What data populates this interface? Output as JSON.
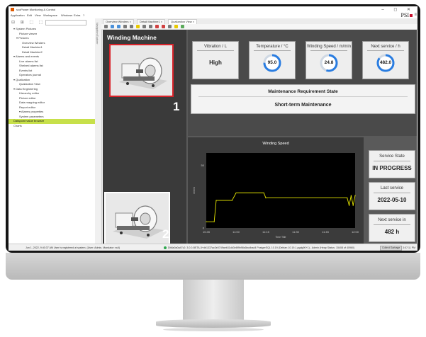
{
  "window": {
    "title": "scoPower Monitoring & Control",
    "controls": "– ◻ ✕",
    "brand": "PSI"
  },
  "menu": [
    "Application",
    "Edit",
    "View",
    "Workspace",
    "Windows",
    "Extra",
    "?"
  ],
  "nav": {
    "tools": "⊟ ⊞ ⬚ ⬚ ⊕",
    "side_label": "Navigation Explorer",
    "items": [
      {
        "label": "▾ System Pictures",
        "indent": 1
      },
      {
        "label": "Picture viewer",
        "indent": 3
      },
      {
        "label": "▾ Pictures",
        "indent": 2
      },
      {
        "label": "Overview Winders",
        "indent": 4
      },
      {
        "label": "Detail Machine1",
        "indent": 4
      },
      {
        "label": "Detail Machine2",
        "indent": 4
      },
      {
        "label": "▾ Alarms and events",
        "indent": 1
      },
      {
        "label": "Live alarms list",
        "indent": 3
      },
      {
        "label": "Shelved alarms list",
        "indent": 3
      },
      {
        "label": "Events list",
        "indent": 3
      },
      {
        "label": "Operators journal",
        "indent": 3
      },
      {
        "label": "▾ Qualization",
        "indent": 1
      },
      {
        "label": "Qualization View",
        "indent": 3
      },
      {
        "label": "▾ Data Engineering",
        "indent": 1
      },
      {
        "label": "Hierarchy editor",
        "indent": 3
      },
      {
        "label": "Picture editor",
        "indent": 3
      },
      {
        "label": "Data mapping editor",
        "indent": 3
      },
      {
        "label": "Report editor",
        "indent": 3
      },
      {
        "label": "▾ Alarms properties",
        "indent": 3
      },
      {
        "label": "System parameters",
        "indent": 3
      },
      {
        "label": "Datapoint value browser",
        "indent": 1,
        "selected": true
      },
      {
        "label": "Charts",
        "indent": 1
      }
    ]
  },
  "tabs": [
    {
      "label": "Overview Winders ×",
      "active": false
    },
    {
      "label": "Detail Machine1 ×",
      "active": false
    },
    {
      "label": "Qualization View ×",
      "active": true
    }
  ],
  "toolbar": {
    "icon_colors": [
      "#7a7a7a",
      "#4a90d9",
      "#4a90d9",
      "#7a7a7a",
      "#7a7a7a",
      "#e8c900",
      "#7a7a7a",
      "#7a7a7a",
      "#d04040",
      "#d04040",
      "#7a7a7a",
      "#e8c900",
      "#5aaa5a"
    ]
  },
  "dashboard": {
    "title": "Winding Machine",
    "machine1_number": "1",
    "machine2_number": "2",
    "cards": [
      {
        "key": "vibration",
        "label": "Vibration / L",
        "value": "High",
        "gauge": false
      },
      {
        "key": "temperature",
        "label": "Temperature / °C",
        "value": "95.0",
        "gauge": true,
        "fraction": 0.75
      },
      {
        "key": "speed",
        "label": "Winding Speed / m/min",
        "value": "24.8",
        "gauge": true,
        "fraction": 0.55
      },
      {
        "key": "nextservice",
        "label": "Next service / h",
        "value": "482.0",
        "gauge": true,
        "fraction": 0.85
      }
    ],
    "maintenance": {
      "title": "Maintenance Requirement State",
      "state": "Short-term Maintenance"
    },
    "service_state": {
      "label": "Service State",
      "value": "IN PROGRESS"
    },
    "last_service": {
      "label": "Last service",
      "value": "2022-05-10"
    },
    "next_service": {
      "label": "Next service in",
      "value": "482 h"
    },
    "colors": {
      "accent_red": "#d9242b",
      "gauge_blue": "#2a7de1",
      "line_yellow": "#e6e600"
    }
  },
  "chart_data": {
    "type": "line",
    "title": "Winding Speed",
    "ylabel": "m/min",
    "xlabel": "Time Title",
    "x_ticks": [
      "10:45",
      "11:00",
      "11:15",
      "11:30",
      "11:45",
      "12:00"
    ],
    "y_ticks": [
      "0",
      "50"
    ],
    "ylim": [
      0,
      60
    ],
    "series": [
      {
        "values": [
          {
            "x": "10:45",
            "y": 5
          },
          {
            "x": "10:49",
            "y": 5
          },
          {
            "x": "10:50",
            "y": 22
          },
          {
            "x": "10:58",
            "y": 22
          },
          {
            "x": "11:00",
            "y": 28
          },
          {
            "x": "11:14",
            "y": 28
          },
          {
            "x": "11:15",
            "y": 24
          },
          {
            "x": "11:56",
            "y": 24
          },
          {
            "x": "11:57",
            "y": 18
          },
          {
            "x": "11:58",
            "y": 26
          },
          {
            "x": "11:59",
            "y": 18
          },
          {
            "x": "12:00",
            "y": 26
          }
        ]
      }
    ]
  },
  "statusbar": {
    "left": "Jun 1, 2022, 9:40:37 AM   User is registered at system. (User: Admin, Mandator: null)",
    "connection": "Db8a0a0a47c2: 3.0.0-BETA-5+db1337ac3e0749aeb31dd3e8f9b98c6bcdbad4 PostgreSQL 10.19 (Debian 10.19-1.pgdg90+1) - Admin (Heap Status: 15408 of 40960)",
    "button": "Collect Garbage",
    "time": "3:07:11 PM"
  }
}
